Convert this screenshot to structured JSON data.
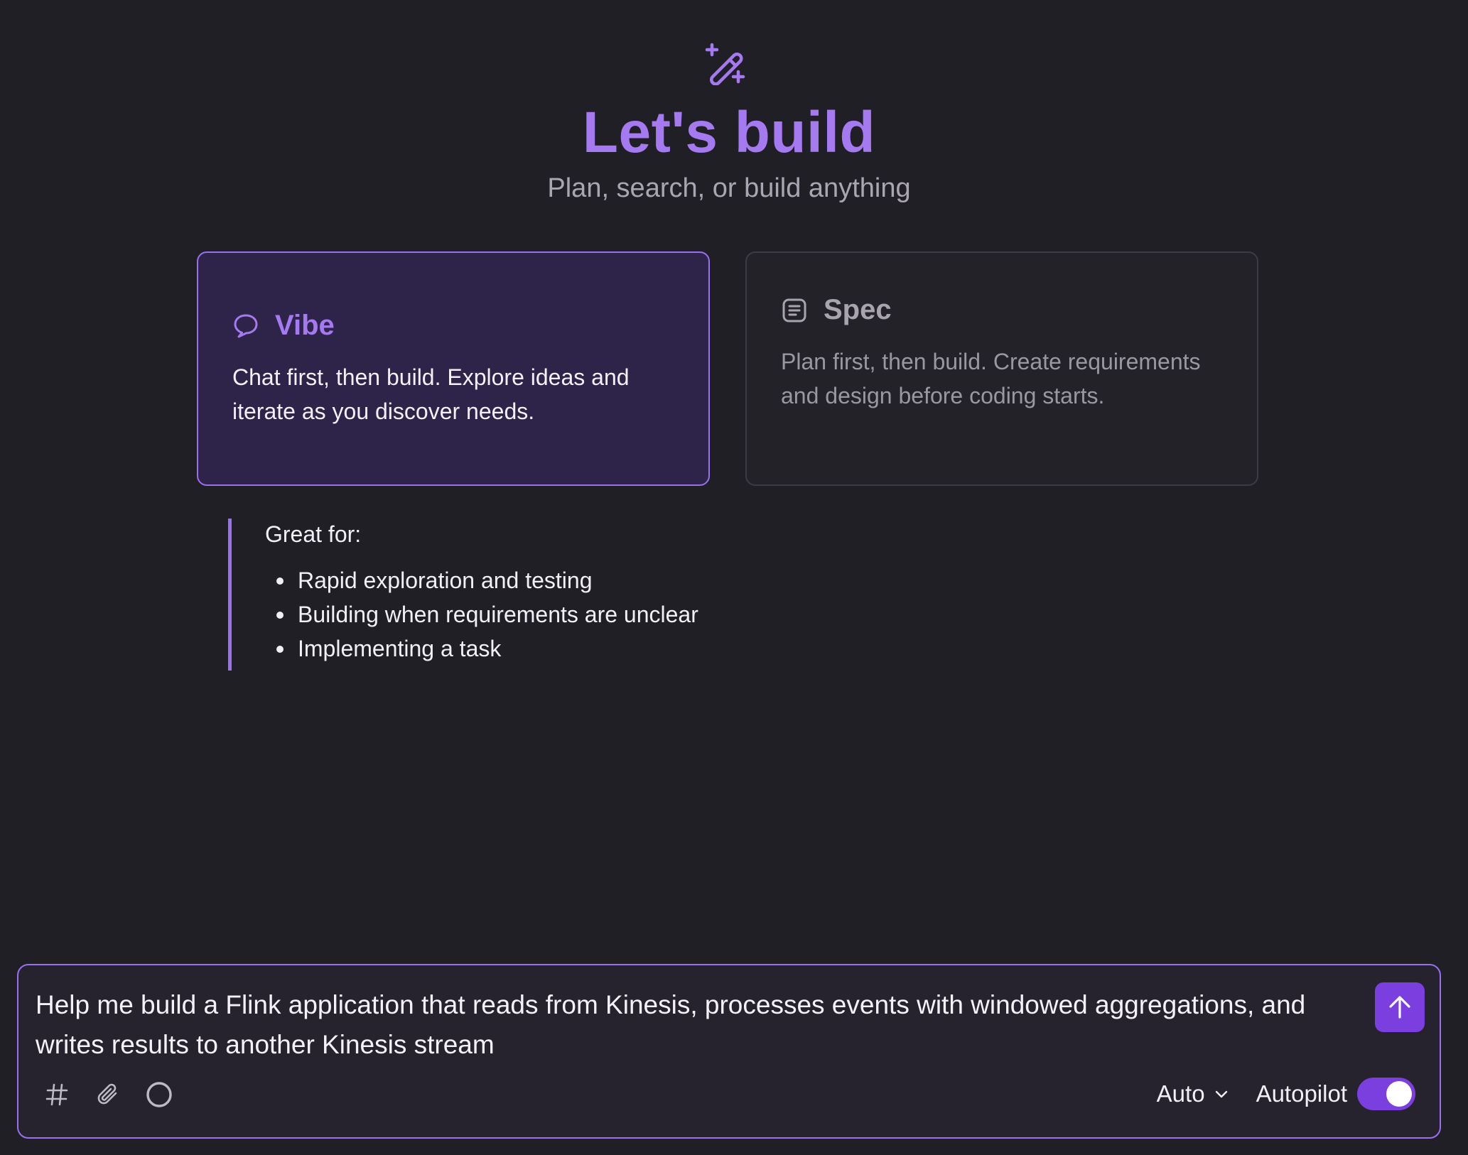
{
  "hero": {
    "icon": "magic-wand-icon",
    "title": "Let's build",
    "subtitle": "Plan, search, or build anything"
  },
  "modes": [
    {
      "id": "vibe",
      "icon": "chat-bubble-icon",
      "title": "Vibe",
      "description": "Chat first, then build. Explore ideas and iterate as you discover needs.",
      "selected": true
    },
    {
      "id": "spec",
      "icon": "document-icon",
      "title": "Spec",
      "description": "Plan first, then build. Create requirements and design before coding starts.",
      "selected": false
    }
  ],
  "great_for": {
    "heading": "Great for:",
    "items": [
      "Rapid exploration and testing",
      "Building when requirements are unclear",
      "Implementing a task"
    ]
  },
  "composer": {
    "text": "Help me build a Flink application that reads from Kinesis, processes events with windowed aggregations, and writes results to another Kinesis stream",
    "send_icon": "arrow-up-icon",
    "tools": [
      "hash-icon",
      "paperclip-icon",
      "circle-icon"
    ],
    "model": "Auto",
    "autopilot_label": "Autopilot",
    "autopilot_on": true
  },
  "colors": {
    "accent": "#9a6ff0",
    "title": "#a57af0",
    "background": "#211f26",
    "button": "#7b3fe0"
  }
}
